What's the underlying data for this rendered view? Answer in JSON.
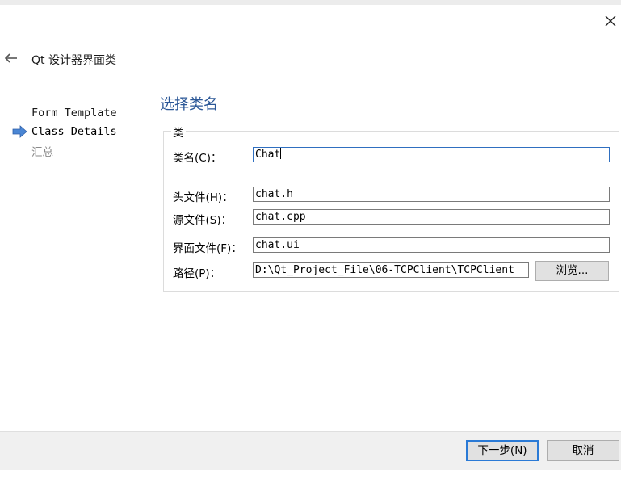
{
  "window": {
    "title": "Qt 设计器界面类"
  },
  "nav": {
    "items": [
      {
        "label": "Form Template",
        "state": "done"
      },
      {
        "label": "Class Details",
        "state": "current"
      },
      {
        "label": "汇总",
        "state": "pending"
      }
    ]
  },
  "page": {
    "title": "选择类名",
    "group_title": "类",
    "class_name": {
      "label": "类名(C)：",
      "value": "Chat"
    },
    "header_file": {
      "label": "头文件(H)：",
      "value": "chat.h"
    },
    "source_file": {
      "label": "源文件(S)：",
      "value": "chat.cpp"
    },
    "form_file": {
      "label": "界面文件(F)：",
      "value": "chat.ui"
    },
    "path": {
      "label": "路径(P)：",
      "value": "D:\\Qt_Project_File\\06-TCPClient\\TCPClient"
    },
    "browse_label": "浏览..."
  },
  "footer": {
    "next_label": "下一步(N)",
    "cancel_label": "取消"
  },
  "colors": {
    "accent": "#2a7ad6",
    "title_blue": "#2b5797",
    "nav_arrow": "#4a86d4"
  }
}
